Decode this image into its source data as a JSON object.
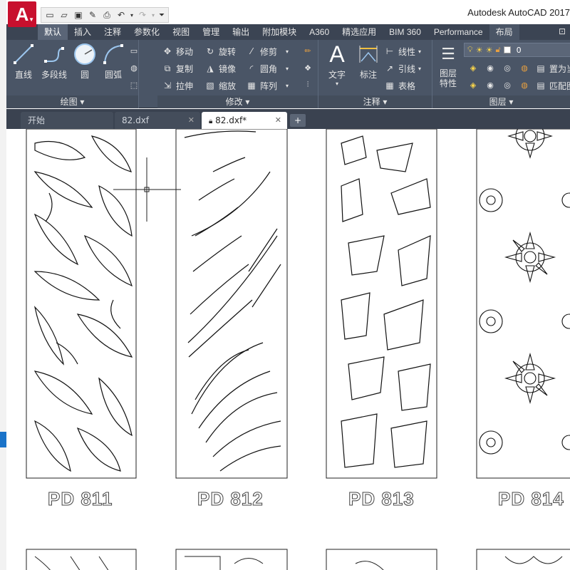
{
  "app": {
    "logo": "A",
    "title": "Autodesk AutoCAD 2017"
  },
  "tabs": [
    "默认",
    "插入",
    "注释",
    "参数化",
    "视图",
    "管理",
    "输出",
    "附加模块",
    "A360",
    "精选应用",
    "BIM 360",
    "Performance",
    "布局"
  ],
  "ribbon": {
    "draw": {
      "footer": "绘图 ▾",
      "line": "直线",
      "polyline": "多段线",
      "circle": "圆",
      "arc": "圆弧"
    },
    "modify": {
      "footer": "修改 ▾",
      "move": "移动",
      "rotate": "旋转",
      "trim": "修剪",
      "copy": "复制",
      "mirror": "镜像",
      "fillet": "圆角",
      "stretch": "拉伸",
      "scale": "缩放",
      "array": "阵列"
    },
    "annotation": {
      "footer": "注释 ▾",
      "text": "文字",
      "dimension": "标注",
      "linear": "线性",
      "leader": "引线",
      "table": "表格"
    },
    "layers": {
      "footer": "图层 ▾",
      "layer_props": "图层\n特性",
      "layer_name": "0",
      "set_current": "置为当",
      "match": "匹配图"
    }
  },
  "doc_tabs": [
    {
      "label": "开始",
      "active": false
    },
    {
      "label": "82.dxf",
      "active": false
    },
    {
      "label": "82.dxf*",
      "active": true
    }
  ],
  "drawing": {
    "labels": [
      "PD 811",
      "PD 812",
      "PD 813",
      "PD 814"
    ]
  },
  "colors": {
    "ribbon": "#4a5566",
    "tabbar": "#3b4453",
    "accent": "#c8102e"
  }
}
